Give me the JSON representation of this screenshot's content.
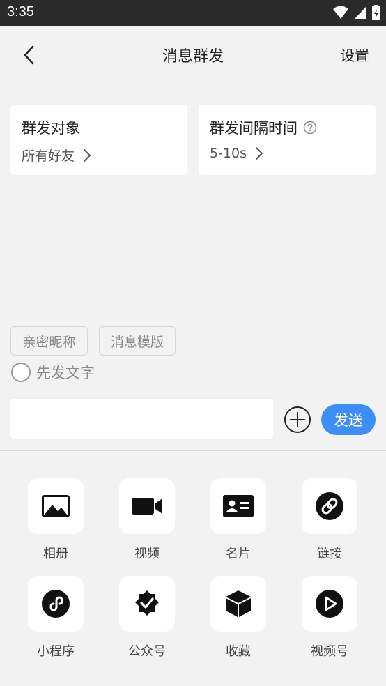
{
  "status_bar": {
    "time": "3:35"
  },
  "header": {
    "title": "消息群发",
    "settings_label": "设置"
  },
  "cards": [
    {
      "title": "群发对象",
      "value": "所有好友"
    },
    {
      "title": "群发间隔时间",
      "value": "5-10s"
    }
  ],
  "chips": [
    "亲密昵称",
    "消息模版"
  ],
  "radio": {
    "label": "先发文字",
    "checked": false
  },
  "composer": {
    "value": "",
    "placeholder": "",
    "send_label": "发送"
  },
  "tools": [
    {
      "label": "相册",
      "icon": "album-icon"
    },
    {
      "label": "视频",
      "icon": "video-icon"
    },
    {
      "label": "名片",
      "icon": "contact-card-icon"
    },
    {
      "label": "链接",
      "icon": "link-icon"
    },
    {
      "label": "小程序",
      "icon": "mini-program-icon"
    },
    {
      "label": "公众号",
      "icon": "official-account-icon"
    },
    {
      "label": "收藏",
      "icon": "favorites-icon"
    },
    {
      "label": "视频号",
      "icon": "channels-icon"
    }
  ],
  "colors": {
    "accent": "#3d8ef8",
    "background": "#f2f2f2",
    "status_bar": "#2b2b2b"
  }
}
